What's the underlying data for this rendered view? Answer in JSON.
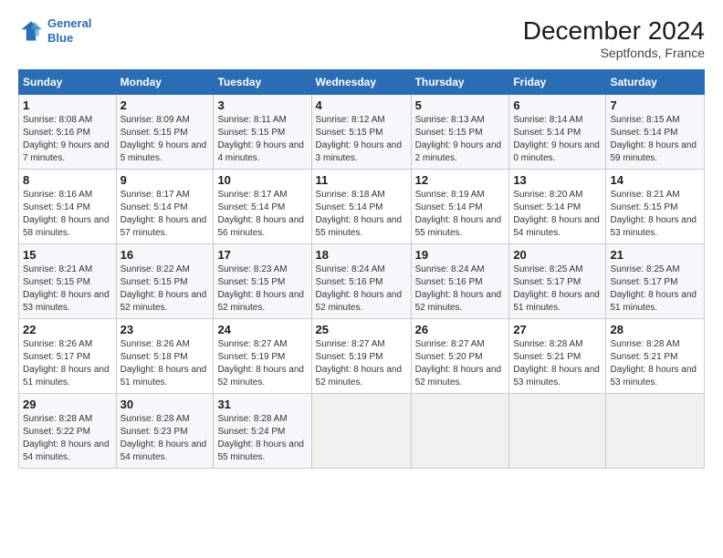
{
  "logo": {
    "line1": "General",
    "line2": "Blue"
  },
  "title": "December 2024",
  "subtitle": "Septfonds, France",
  "days_header": [
    "Sunday",
    "Monday",
    "Tuesday",
    "Wednesday",
    "Thursday",
    "Friday",
    "Saturday"
  ],
  "weeks": [
    [
      {
        "day": "1",
        "sunrise": "Sunrise: 8:08 AM",
        "sunset": "Sunset: 5:16 PM",
        "daylight": "Daylight: 9 hours and 7 minutes."
      },
      {
        "day": "2",
        "sunrise": "Sunrise: 8:09 AM",
        "sunset": "Sunset: 5:15 PM",
        "daylight": "Daylight: 9 hours and 5 minutes."
      },
      {
        "day": "3",
        "sunrise": "Sunrise: 8:11 AM",
        "sunset": "Sunset: 5:15 PM",
        "daylight": "Daylight: 9 hours and 4 minutes."
      },
      {
        "day": "4",
        "sunrise": "Sunrise: 8:12 AM",
        "sunset": "Sunset: 5:15 PM",
        "daylight": "Daylight: 9 hours and 3 minutes."
      },
      {
        "day": "5",
        "sunrise": "Sunrise: 8:13 AM",
        "sunset": "Sunset: 5:15 PM",
        "daylight": "Daylight: 9 hours and 2 minutes."
      },
      {
        "day": "6",
        "sunrise": "Sunrise: 8:14 AM",
        "sunset": "Sunset: 5:14 PM",
        "daylight": "Daylight: 9 hours and 0 minutes."
      },
      {
        "day": "7",
        "sunrise": "Sunrise: 8:15 AM",
        "sunset": "Sunset: 5:14 PM",
        "daylight": "Daylight: 8 hours and 59 minutes."
      }
    ],
    [
      {
        "day": "8",
        "sunrise": "Sunrise: 8:16 AM",
        "sunset": "Sunset: 5:14 PM",
        "daylight": "Daylight: 8 hours and 58 minutes."
      },
      {
        "day": "9",
        "sunrise": "Sunrise: 8:17 AM",
        "sunset": "Sunset: 5:14 PM",
        "daylight": "Daylight: 8 hours and 57 minutes."
      },
      {
        "day": "10",
        "sunrise": "Sunrise: 8:17 AM",
        "sunset": "Sunset: 5:14 PM",
        "daylight": "Daylight: 8 hours and 56 minutes."
      },
      {
        "day": "11",
        "sunrise": "Sunrise: 8:18 AM",
        "sunset": "Sunset: 5:14 PM",
        "daylight": "Daylight: 8 hours and 55 minutes."
      },
      {
        "day": "12",
        "sunrise": "Sunrise: 8:19 AM",
        "sunset": "Sunset: 5:14 PM",
        "daylight": "Daylight: 8 hours and 55 minutes."
      },
      {
        "day": "13",
        "sunrise": "Sunrise: 8:20 AM",
        "sunset": "Sunset: 5:14 PM",
        "daylight": "Daylight: 8 hours and 54 minutes."
      },
      {
        "day": "14",
        "sunrise": "Sunrise: 8:21 AM",
        "sunset": "Sunset: 5:15 PM",
        "daylight": "Daylight: 8 hours and 53 minutes."
      }
    ],
    [
      {
        "day": "15",
        "sunrise": "Sunrise: 8:21 AM",
        "sunset": "Sunset: 5:15 PM",
        "daylight": "Daylight: 8 hours and 53 minutes."
      },
      {
        "day": "16",
        "sunrise": "Sunrise: 8:22 AM",
        "sunset": "Sunset: 5:15 PM",
        "daylight": "Daylight: 8 hours and 52 minutes."
      },
      {
        "day": "17",
        "sunrise": "Sunrise: 8:23 AM",
        "sunset": "Sunset: 5:15 PM",
        "daylight": "Daylight: 8 hours and 52 minutes."
      },
      {
        "day": "18",
        "sunrise": "Sunrise: 8:24 AM",
        "sunset": "Sunset: 5:16 PM",
        "daylight": "Daylight: 8 hours and 52 minutes."
      },
      {
        "day": "19",
        "sunrise": "Sunrise: 8:24 AM",
        "sunset": "Sunset: 5:16 PM",
        "daylight": "Daylight: 8 hours and 52 minutes."
      },
      {
        "day": "20",
        "sunrise": "Sunrise: 8:25 AM",
        "sunset": "Sunset: 5:17 PM",
        "daylight": "Daylight: 8 hours and 51 minutes."
      },
      {
        "day": "21",
        "sunrise": "Sunrise: 8:25 AM",
        "sunset": "Sunset: 5:17 PM",
        "daylight": "Daylight: 8 hours and 51 minutes."
      }
    ],
    [
      {
        "day": "22",
        "sunrise": "Sunrise: 8:26 AM",
        "sunset": "Sunset: 5:17 PM",
        "daylight": "Daylight: 8 hours and 51 minutes."
      },
      {
        "day": "23",
        "sunrise": "Sunrise: 8:26 AM",
        "sunset": "Sunset: 5:18 PM",
        "daylight": "Daylight: 8 hours and 51 minutes."
      },
      {
        "day": "24",
        "sunrise": "Sunrise: 8:27 AM",
        "sunset": "Sunset: 5:19 PM",
        "daylight": "Daylight: 8 hours and 52 minutes."
      },
      {
        "day": "25",
        "sunrise": "Sunrise: 8:27 AM",
        "sunset": "Sunset: 5:19 PM",
        "daylight": "Daylight: 8 hours and 52 minutes."
      },
      {
        "day": "26",
        "sunrise": "Sunrise: 8:27 AM",
        "sunset": "Sunset: 5:20 PM",
        "daylight": "Daylight: 8 hours and 52 minutes."
      },
      {
        "day": "27",
        "sunrise": "Sunrise: 8:28 AM",
        "sunset": "Sunset: 5:21 PM",
        "daylight": "Daylight: 8 hours and 53 minutes."
      },
      {
        "day": "28",
        "sunrise": "Sunrise: 8:28 AM",
        "sunset": "Sunset: 5:21 PM",
        "daylight": "Daylight: 8 hours and 53 minutes."
      }
    ],
    [
      {
        "day": "29",
        "sunrise": "Sunrise: 8:28 AM",
        "sunset": "Sunset: 5:22 PM",
        "daylight": "Daylight: 8 hours and 54 minutes."
      },
      {
        "day": "30",
        "sunrise": "Sunrise: 8:28 AM",
        "sunset": "Sunset: 5:23 PM",
        "daylight": "Daylight: 8 hours and 54 minutes."
      },
      {
        "day": "31",
        "sunrise": "Sunrise: 8:28 AM",
        "sunset": "Sunset: 5:24 PM",
        "daylight": "Daylight: 8 hours and 55 minutes."
      },
      null,
      null,
      null,
      null
    ]
  ]
}
